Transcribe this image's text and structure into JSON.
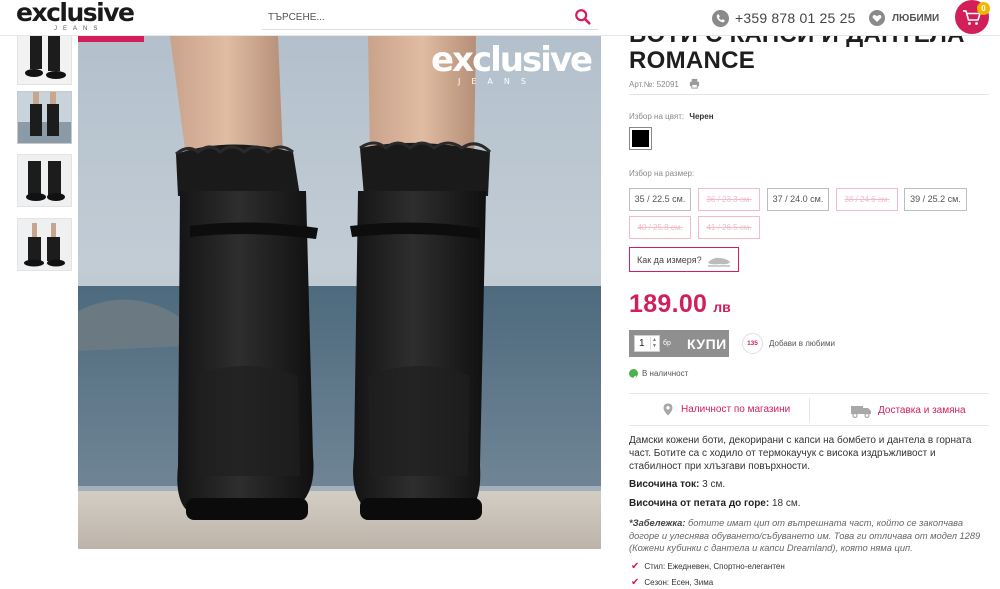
{
  "header": {
    "logo_text": "exclusive",
    "logo_sub": "JEANS",
    "search_placeholder": "ТЪРСЕНЕ...",
    "phone": "+359 878 01 25 25",
    "favorites_label": "ЛЮБИМИ",
    "cart_count": "0"
  },
  "gallery": {
    "watermark_text": "exclusive",
    "watermark_sub": "JEANS"
  },
  "product": {
    "title_line1": "БОТИ С КАПСИ И ДАНТЕЛА",
    "title_line2": "ROMANCE",
    "sku": "Арт.№: 52091",
    "color_label": "Избор на цвят:",
    "color_value": "Черен",
    "size_label": "Избор на размер:",
    "sizes": [
      {
        "label": "35 / 22.5 см.",
        "available": true
      },
      {
        "label": "36 / 23.3 см.",
        "available": false
      },
      {
        "label": "37 / 24.0 см.",
        "available": true
      },
      {
        "label": "38 / 24.6 см.",
        "available": false
      },
      {
        "label": "39 / 25.2 см.",
        "available": true
      },
      {
        "label": "40 / 25.8 см.",
        "available": false
      },
      {
        "label": "41 / 26.5 см.",
        "available": false
      }
    ],
    "measure_label": "Как да измеря?",
    "price": "189.00",
    "currency": "лв",
    "qty": "1",
    "qty_unit": "бр",
    "buy_label": "КУПИ",
    "wish_count": "135",
    "wish_label": "Добави в любими",
    "stock_label": "В наличност",
    "store_link": "Наличност по магазини",
    "delivery_link": "Доставка и замяна",
    "description": "Дамски кожени боти, декорирани с капси на бомбето и дантела в горната част. Ботите са с ходило от термокаучук с висока издръжливост и стабилност при хлъзгави повърхности.",
    "heel_label": "Височина ток:",
    "heel_value": "3 см.",
    "height_label": "Височина от петата до горе:",
    "height_value": "18 см.",
    "note_label": "*Забележка:",
    "note_text": "ботите имат цип от вътрешната част, който се закопчава догоре и улеснява обуването/събуването им. Това ги отличава от модел 1289 (Кожени кубинки с дантела и капси Dreamland), която няма цип.",
    "features": [
      "Стил: Ежедневен, Спортно-елегантен",
      "Сезон: Есен, Зима"
    ]
  },
  "colors": {
    "accent": "#d21f59",
    "badge": "#f2b600",
    "buy_bg": "#8f8f8f",
    "stock": "#4caf50"
  }
}
